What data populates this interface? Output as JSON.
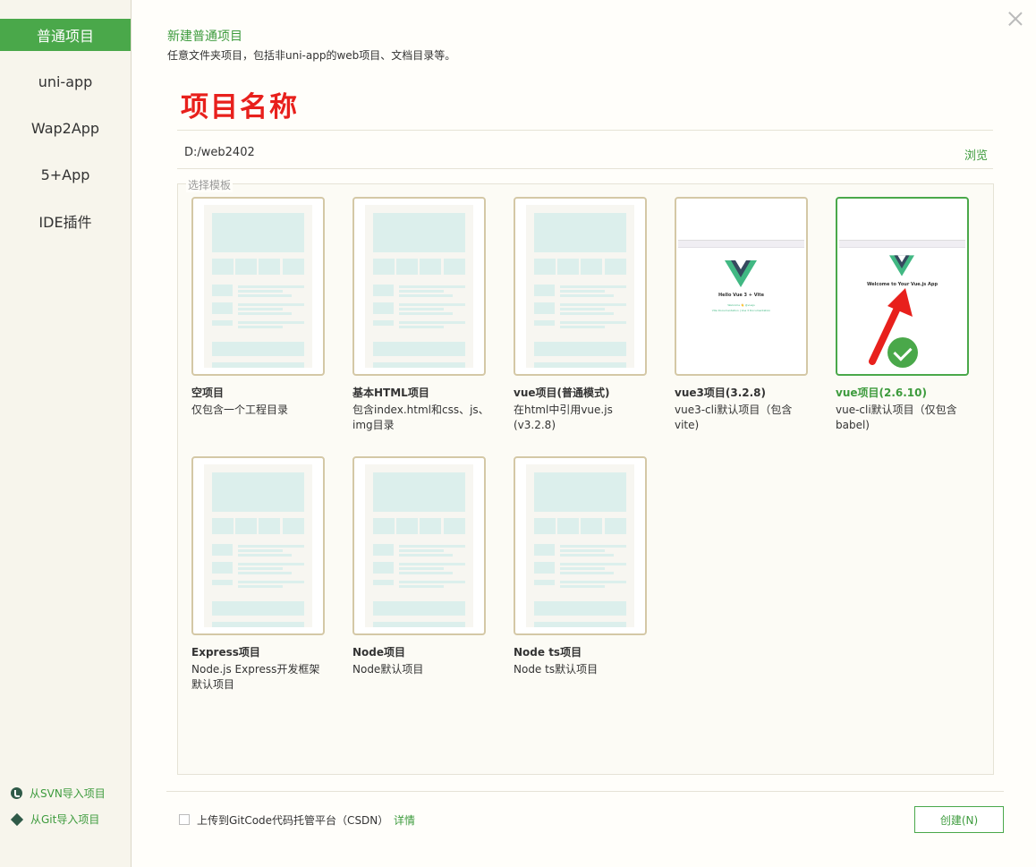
{
  "sidebar": {
    "items": [
      {
        "label": "普通项目"
      },
      {
        "label": "uni-app"
      },
      {
        "label": "Wap2App"
      },
      {
        "label": "5+App"
      },
      {
        "label": "IDE插件"
      }
    ],
    "import_svn": "从SVN导入项目",
    "import_git": "从Git导入项目"
  },
  "header": {
    "title": "新建普通项目",
    "subtitle": "任意文件夹项目，包括非uni-app的web项目、文档目录等。"
  },
  "form": {
    "project_name": "项目名称",
    "path": "D:/web2402",
    "browse_label": "浏览",
    "template_legend": "选择模板"
  },
  "templates": [
    {
      "name": "空项目",
      "desc": "仅包含一个工程目录"
    },
    {
      "name": "基本HTML项目",
      "desc": "包含index.html和css、js、img目录"
    },
    {
      "name": "vue项目(普通模式)",
      "desc": "在html中引用vue.js (v3.2.8)"
    },
    {
      "name": "vue3项目(3.2.8)",
      "desc": "vue3-cli默认项目（包含vite)"
    },
    {
      "name": "vue项目(2.6.10)",
      "desc": "vue-cli默认项目（仅包含babel)"
    },
    {
      "name": "Express项目",
      "desc": "Node.js Express开发框架默认项目"
    },
    {
      "name": "Node项目",
      "desc": "Node默认项目"
    },
    {
      "name": "Node ts项目",
      "desc": "Node ts默认项目"
    }
  ],
  "previews": {
    "vite_heading": "Hello Vue 3 + Vite",
    "vite_line1": "Welcome 👋 @vuejs",
    "vite_line2": "Vite Documentation | Vue 3 Documentation",
    "vue_heading": "Welcome to Your Vue.js App"
  },
  "footer": {
    "upload_label": "上传到GitCode代码托管平台（CSDN）",
    "details_label": "详情",
    "create_label": "创建(N)"
  },
  "colors": {
    "accent": "#4aa84a",
    "annotation": "#e8201c"
  }
}
